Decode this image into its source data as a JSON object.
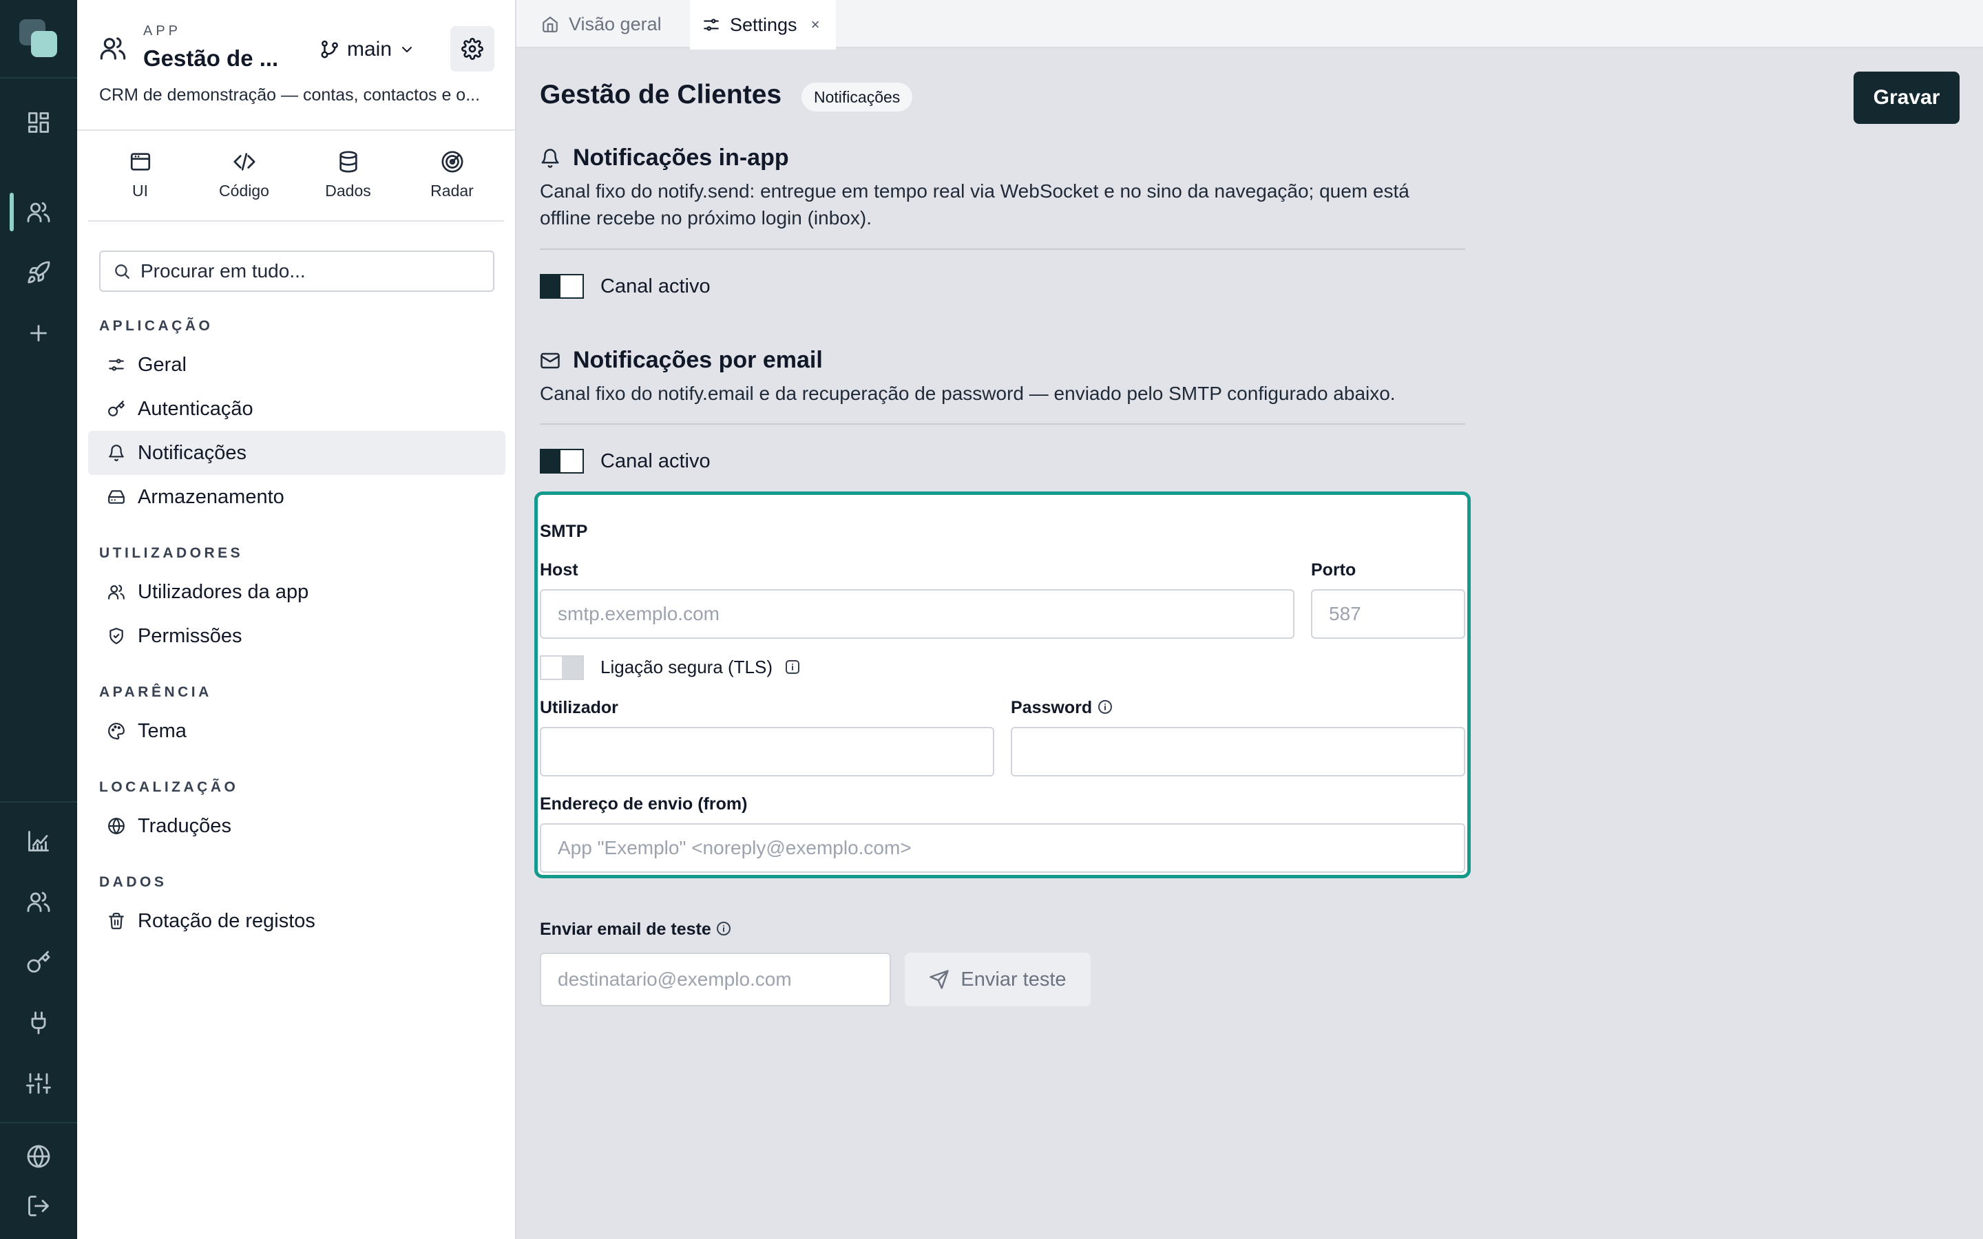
{
  "rail": {
    "logo": "app-logo",
    "icons": [
      "dashboard-icon",
      "users-icon",
      "rocket-icon",
      "plus-icon",
      "analytics-icon",
      "team-icon",
      "key-icon",
      "plug-icon",
      "sliders-icon",
      "globe-icon",
      "logout-icon"
    ],
    "accent": "#8fd1c8"
  },
  "sidebar": {
    "app_kicker": "APP",
    "app_name": "Gestão de ...",
    "branch": "main",
    "description": "CRM de demonstração — contas, contactos e o...",
    "modes": [
      {
        "label": "UI",
        "icon": "window-icon"
      },
      {
        "label": "Código",
        "icon": "code-icon"
      },
      {
        "label": "Dados",
        "icon": "database-icon"
      },
      {
        "label": "Radar",
        "icon": "radar-icon"
      }
    ],
    "search_placeholder": "Procurar em tudo...",
    "sections": [
      {
        "title": "APLICAÇÃO",
        "items": [
          {
            "label": "Geral",
            "icon": "sliders-icon"
          },
          {
            "label": "Autenticação",
            "icon": "key-icon"
          },
          {
            "label": "Notificações",
            "icon": "bell-icon",
            "active": true
          },
          {
            "label": "Armazenamento",
            "icon": "hard-drive-icon"
          }
        ]
      },
      {
        "title": "UTILIZADORES",
        "items": [
          {
            "label": "Utilizadores da app",
            "icon": "users-icon"
          },
          {
            "label": "Permissões",
            "icon": "shield-check-icon"
          }
        ]
      },
      {
        "title": "APARÊNCIA",
        "items": [
          {
            "label": "Tema",
            "icon": "palette-icon"
          }
        ]
      },
      {
        "title": "LOCALIZAÇÃO",
        "items": [
          {
            "label": "Traduções",
            "icon": "globe-icon"
          }
        ]
      },
      {
        "title": "DADOS",
        "items": [
          {
            "label": "Rotação de registos",
            "icon": "trash-icon"
          }
        ]
      }
    ]
  },
  "tabs": [
    {
      "label": "Visão geral",
      "icon": "home-icon",
      "active": false
    },
    {
      "label": "Settings",
      "icon": "settings-sliders-icon",
      "active": true,
      "close": "×"
    }
  ],
  "page": {
    "title": "Gestão de Clientes",
    "badge": "Notificações",
    "save_label": "Gravar"
  },
  "inapp": {
    "title": "Notificações in-app",
    "description": "Canal fixo do notify.send: entregue em tempo real via WebSocket e no sino da navegação; quem está offline recebe no próximo login (inbox).",
    "toggle_label": "Canal activo",
    "enabled": true
  },
  "email": {
    "title": "Notificações por email",
    "description": "Canal fixo do notify.email e da recuperação de password — enviado pelo SMTP configurado abaixo.",
    "toggle_label": "Canal activo",
    "enabled": true
  },
  "smtp": {
    "heading": "SMTP",
    "host_label": "Host",
    "host_placeholder": "smtp.exemplo.com",
    "host_value": "",
    "port_label": "Porto",
    "port_placeholder": "587",
    "port_value": "",
    "tls_label": "Ligação segura (TLS)",
    "tls_enabled": false,
    "user_label": "Utilizador",
    "user_value": "",
    "password_label": "Password",
    "password_value": "",
    "from_label": "Endereço de envio (from)",
    "from_placeholder": "App \"Exemplo\" <noreply@exemplo.com>",
    "from_value": "",
    "highlight_color": "#139a8c"
  },
  "test_email": {
    "label": "Enviar email de teste",
    "placeholder": "destinatario@exemplo.com",
    "button_label": "Enviar teste"
  }
}
